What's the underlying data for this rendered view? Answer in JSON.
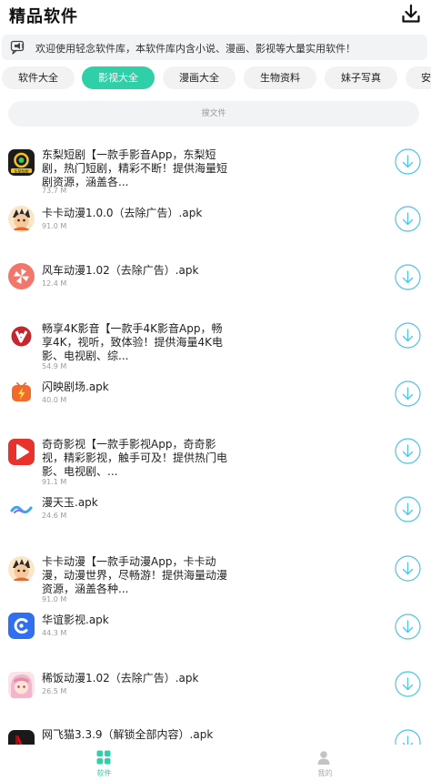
{
  "header": {
    "title": "精品软件",
    "download_icon": "download-icon"
  },
  "notice": {
    "text": "欢迎使用轻念软件库，本软件库内含小说、漫画、影视等大量实用软件！",
    "icon": "megaphone-icon"
  },
  "categories": [
    {
      "label": "软件大全",
      "active": false
    },
    {
      "label": "影视大全",
      "active": true
    },
    {
      "label": "漫画大全",
      "active": false
    },
    {
      "label": "生物资料",
      "active": false
    },
    {
      "label": "妹子写真",
      "active": false
    },
    {
      "label": "安",
      "active": false
    }
  ],
  "search": {
    "placeholder": "搜文件"
  },
  "apps": [
    {
      "name": "东梨短剧【一款手影音App，东梨短剧，热门短剧，精彩不断！提供海量短剧资源，涵盖各...",
      "size": "73.7 M",
      "icon": "dongli-icon",
      "icon_label": "东梨短剧"
    },
    {
      "name": "卡卡动漫1.0.0（去除广告）.apk",
      "size": "91.0 M",
      "icon": "kaka-icon"
    },
    {
      "name": "风车动漫1.02（去除广告）.apk",
      "size": "12.4 M",
      "icon": "fengche-icon"
    },
    {
      "name": "畅享4K影音【一款手4K影音App，畅享4K，视听，致体验！提供海量4K电影、电视剧、综...",
      "size": "54.9 M",
      "icon": "changxiang-icon"
    },
    {
      "name": "闪映剧场.apk",
      "size": "40.0 M",
      "icon": "shanying-icon"
    },
    {
      "name": "奇奇影视【一款手影视App，奇奇影视，精彩影视，触手可及！提供热门电影、电视剧、...",
      "size": "91.1 M",
      "icon": "qiqi-icon"
    },
    {
      "name": "漫天玉.apk",
      "size": "24.6 M",
      "icon": "mantianyu-icon"
    },
    {
      "name": "卡卡动漫【一款手动漫App，卡卡动漫，动漫世界，尽畅游！提供海量动漫资源，涵盖各种...",
      "size": "91.0 M",
      "icon": "kaka-icon"
    },
    {
      "name": "华谊影视.apk",
      "size": "44.3 M",
      "icon": "huayi-icon"
    },
    {
      "name": "稀饭动漫1.02（去除广告）.apk",
      "size": "26.5 M",
      "icon": "xifan-icon"
    },
    {
      "name": "网飞猫3.3.9（解锁全部内容）.apk",
      "size": "",
      "icon": "wangfeimao-icon"
    }
  ],
  "tabs": [
    {
      "label": "软件",
      "active": true,
      "icon": "grid-icon"
    },
    {
      "label": "我的",
      "active": false,
      "icon": "user-icon"
    }
  ],
  "colors": {
    "accent": "#2fcfa8",
    "download": "#4fc4e6"
  }
}
